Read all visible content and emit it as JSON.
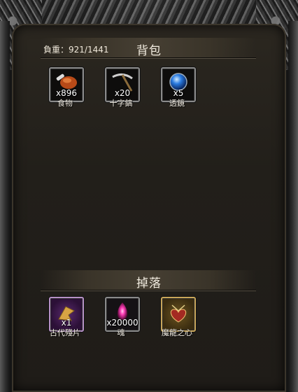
{
  "bag": {
    "title": "背包",
    "weight_label": "負重：921/1441",
    "items": [
      {
        "name": "食物",
        "count": "x896",
        "icon": "meat-icon"
      },
      {
        "name": "十字鎬",
        "count": "x20",
        "icon": "pickaxe-icon"
      },
      {
        "name": "透鏡",
        "count": "x5",
        "icon": "lens-icon"
      }
    ]
  },
  "drop": {
    "title": "掉落",
    "items": [
      {
        "name": "古代殘片",
        "count": "x1",
        "icon": "ancient-fragment-icon"
      },
      {
        "name": "魂",
        "count": "x20000",
        "icon": "soul-icon"
      },
      {
        "name": "魔龍之心",
        "count": "",
        "icon": "dragon-heart-icon"
      }
    ]
  },
  "colors": {
    "panel": "#221f1a",
    "rare_purple": "#5a2a6e",
    "legend_gold": "#c9a659"
  }
}
